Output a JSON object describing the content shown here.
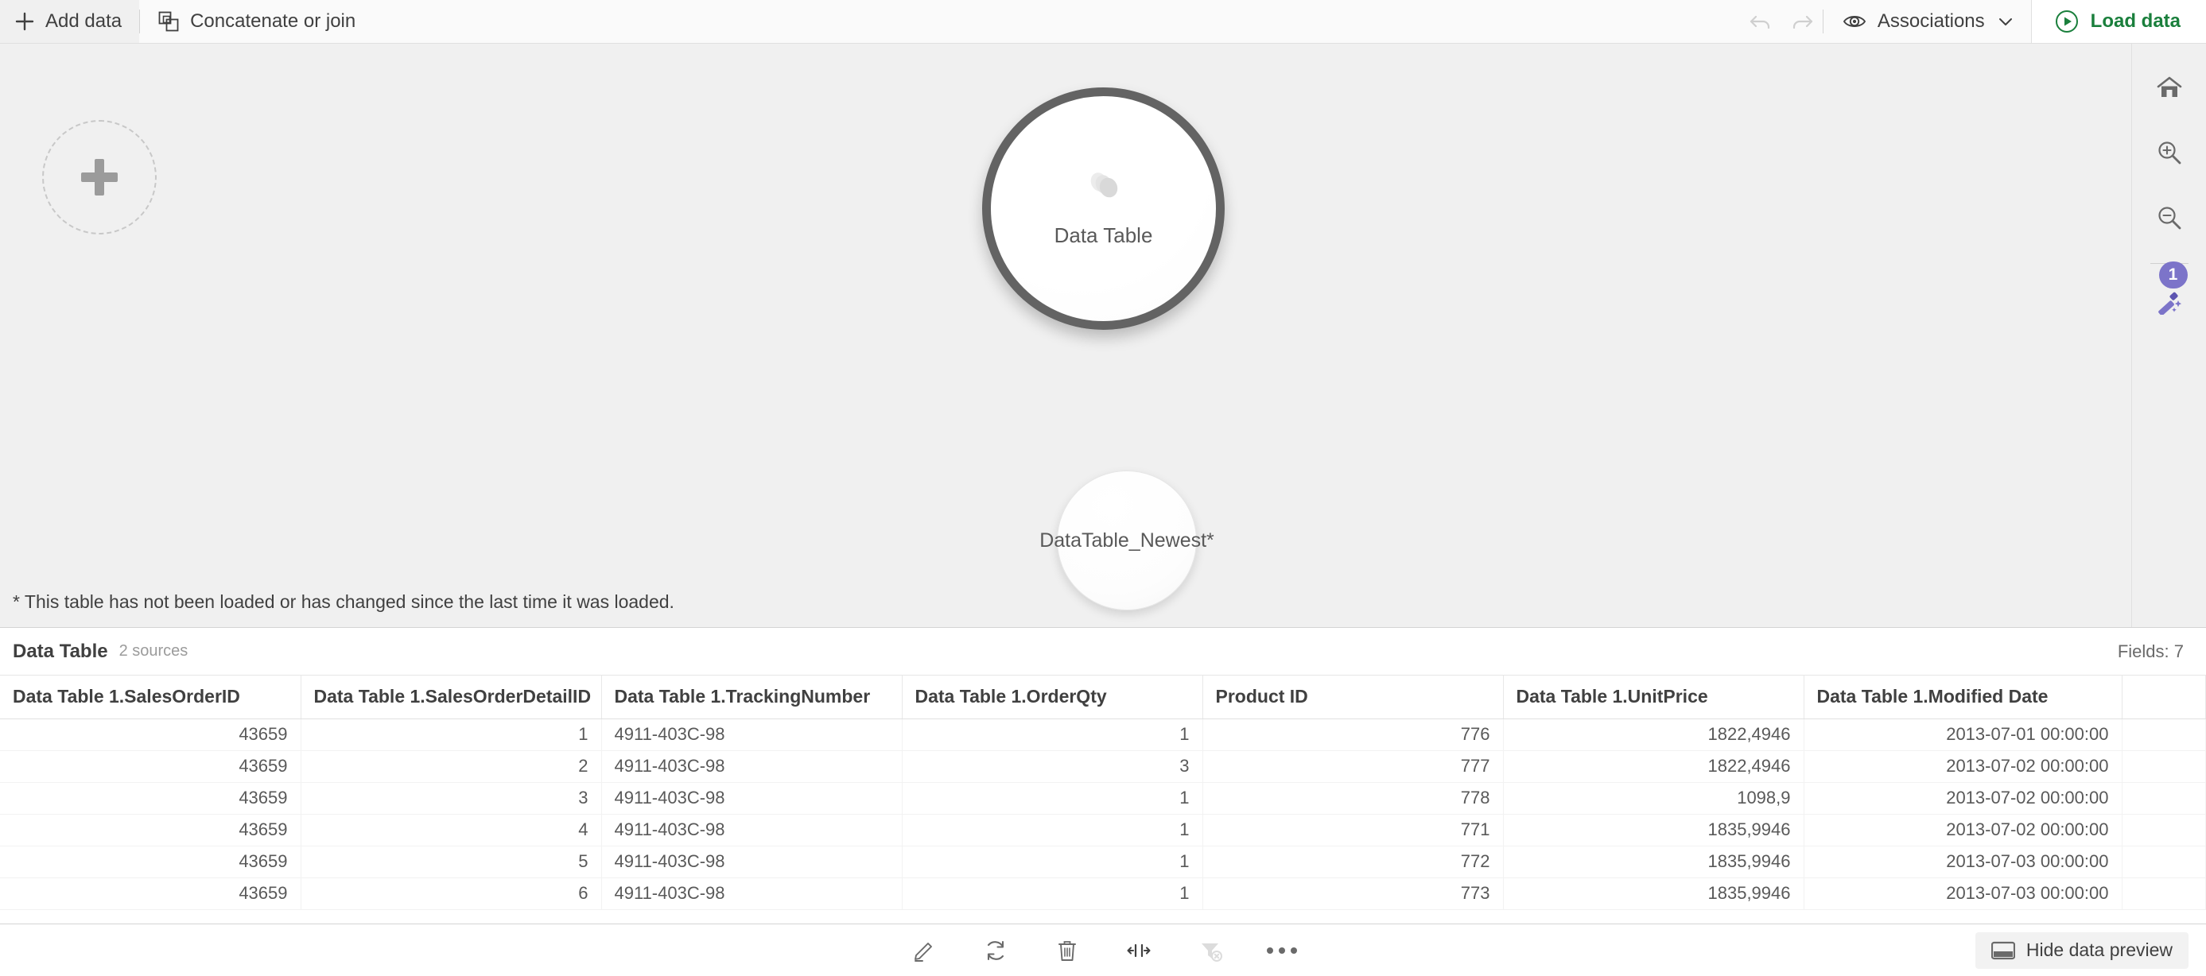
{
  "toolbar": {
    "add_data_label": "Add data",
    "concatenate_label": "Concatenate or join",
    "undo_icon": "undo-icon",
    "redo_icon": "redo-icon",
    "associations_label": "Associations",
    "load_data_label": "Load data",
    "accent_green": "#1a7f3c"
  },
  "canvas": {
    "add_table_placeholder": "add-table-placeholder",
    "tables": [
      {
        "label": "Data Table",
        "selected": true,
        "icon": "stacked-disks-icon"
      },
      {
        "label": "DataTable_Newest*",
        "selected": false,
        "icon": ""
      }
    ],
    "footnote": "* This table has not been loaded or has changed since the last time it was loaded.",
    "background": "#f0f0f0"
  },
  "right_rail": {
    "home_icon": "home-icon",
    "zoom_in_icon": "zoom-in-icon",
    "zoom_out_icon": "zoom-out-icon",
    "wand_icon": "magic-wand-icon",
    "wand_badge": "1",
    "badge_color": "#7c74c9"
  },
  "preview": {
    "title": "Data Table",
    "sources": "2 sources",
    "fields_label": "Fields: 7",
    "columns": [
      "Data Table 1.SalesOrderID",
      "Data Table 1.SalesOrderDetailID",
      "Data Table 1.TrackingNumber",
      "Data Table 1.OrderQty",
      "Product ID",
      "Data Table 1.UnitPrice",
      "Data Table 1.Modified Date"
    ],
    "rows": [
      [
        "43659",
        "1",
        "4911-403C-98",
        "1",
        "776",
        "1822,4946",
        "2013-07-01 00:00:00"
      ],
      [
        "43659",
        "2",
        "4911-403C-98",
        "3",
        "777",
        "1822,4946",
        "2013-07-02 00:00:00"
      ],
      [
        "43659",
        "3",
        "4911-403C-98",
        "1",
        "778",
        "1098,9",
        "2013-07-02 00:00:00"
      ],
      [
        "43659",
        "4",
        "4911-403C-98",
        "1",
        "771",
        "1835,9946",
        "2013-07-02 00:00:00"
      ],
      [
        "43659",
        "5",
        "4911-403C-98",
        "1",
        "772",
        "1835,9946",
        "2013-07-03 00:00:00"
      ],
      [
        "43659",
        "6",
        "4911-403C-98",
        "1",
        "773",
        "1835,9946",
        "2013-07-03 00:00:00"
      ]
    ]
  },
  "bottombar": {
    "edit_icon": "edit-pencil-icon",
    "refresh_icon": "refresh-icon",
    "delete_icon": "trash-icon",
    "split_icon": "split-columns-icon",
    "clear_filter_icon": "clear-filter-icon",
    "more_icon": "more-ellipsis-icon",
    "hide_preview_label": "Hide data preview",
    "hide_preview_icon": "panel-icon"
  }
}
